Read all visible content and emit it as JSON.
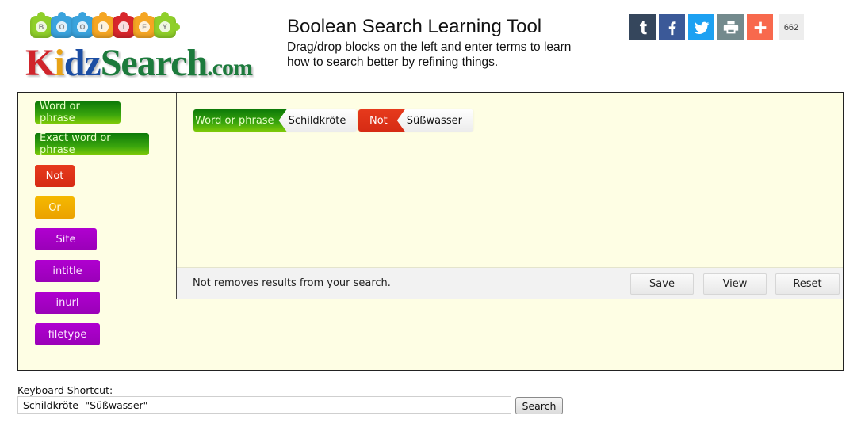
{
  "logo": {
    "puzzle_letters": [
      "B",
      "O",
      "O",
      "L",
      "I",
      "F",
      "Y"
    ],
    "puzzle_colors": [
      "#8fcf2a",
      "#3aa3dd",
      "#3aa3dd",
      "#f5a623",
      "#d8262c",
      "#f5a623",
      "#8fcf2a"
    ],
    "text_k": "K",
    "text_i": "i",
    "text_d": "d",
    "text_z": "z",
    "text_rest": "Search",
    "text_domain": ".com"
  },
  "header": {
    "title": "Boolean Search Learning Tool",
    "subtitle": "Drag/drop blocks on the left and enter terms to learn how to search better by refining things."
  },
  "share": {
    "buttons": [
      {
        "name": "tumblr",
        "icon": "tumblr-icon",
        "color": "#35465c"
      },
      {
        "name": "facebook",
        "icon": "facebook-icon",
        "color": "#3b5998"
      },
      {
        "name": "twitter",
        "icon": "twitter-icon",
        "color": "#1da1f2"
      },
      {
        "name": "print",
        "icon": "print-icon",
        "color": "#738a8d"
      },
      {
        "name": "more",
        "icon": "plus-icon",
        "color": "#f8694d"
      }
    ],
    "count": "662"
  },
  "palette": {
    "blocks": [
      {
        "label": "Word or phrase",
        "type": "green"
      },
      {
        "label": "Exact word or phrase",
        "type": "green"
      },
      {
        "label": "Not",
        "type": "red"
      },
      {
        "label": "Or",
        "type": "orange"
      },
      {
        "label": "Site",
        "type": "purple"
      },
      {
        "label": "intitle",
        "type": "purple"
      },
      {
        "label": "inurl",
        "type": "purple"
      },
      {
        "label": "filetype",
        "type": "purple"
      }
    ]
  },
  "query": {
    "blocks": [
      {
        "operator": "Word or phrase",
        "term": "Schildkröte",
        "type": "green"
      },
      {
        "operator": "Not",
        "term": "Süßwasser",
        "type": "red"
      }
    ]
  },
  "hintbar": {
    "hint": "Not removes results from your search.",
    "save_label": "Save",
    "view_label": "View",
    "reset_label": "Reset"
  },
  "keyboard": {
    "label": "Keyboard Shortcut:",
    "value": "Schildkröte -\"Süßwasser\"",
    "search_label": "Search"
  },
  "colors": {
    "workspace_bg": "#fefee4",
    "hintbar_bg": "#f2f2f2"
  }
}
